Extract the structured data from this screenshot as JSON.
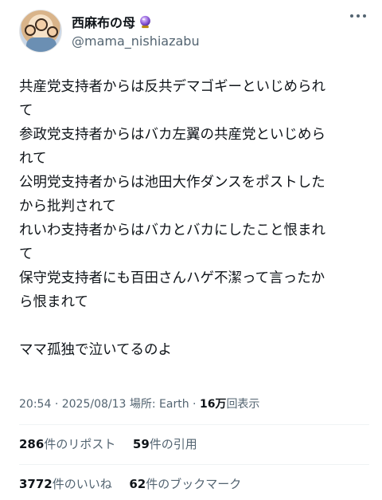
{
  "user": {
    "display_name": "西麻布の母",
    "handle": "@mama_nishiazabu",
    "badge_icon": "crystal-ball-icon"
  },
  "tweet": {
    "lines": [
      "共産党支持者からは反共デマゴギーといじめられ",
      "て",
      "参政党支持者からはバカ左翼の共産党といじめら",
      "れて",
      "公明党支持者からは池田大作ダンスをポストした",
      "から批判されて",
      "れいわ支持者からはバカとバカにしたこと恨まれ",
      "て",
      "保守党支持者にも百田さんハゲ不潔って言ったか",
      "ら恨まれて",
      "",
      "ママ孤独で泣いてるのよ"
    ]
  },
  "meta": {
    "time": "20:54",
    "sep": "·",
    "date": "2025/08/13",
    "location": "場所: Earth",
    "views_count": "16万",
    "views_label": "回表示"
  },
  "stats": {
    "reposts_count": "286",
    "reposts_label": "件のリポスト",
    "quotes_count": "59",
    "quotes_label": "件の引用",
    "likes_count": "3772",
    "likes_label": "件のいいね",
    "bookmarks_count": "62",
    "bookmarks_label": "件のブックマーク"
  },
  "colors": {
    "text": "#0f1419",
    "secondary": "#536471",
    "divider": "#eff3f4",
    "badge": "#8a5cd6"
  }
}
